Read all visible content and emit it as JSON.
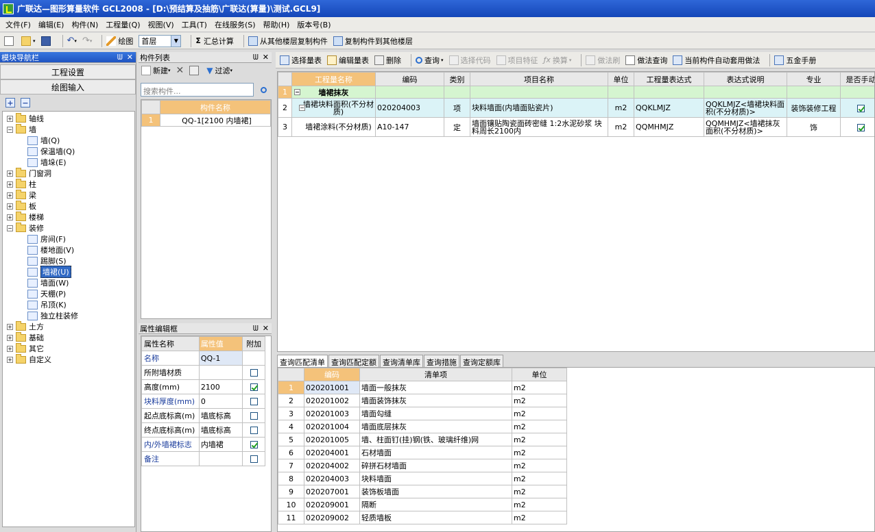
{
  "window": {
    "title": "广联达—图形算量软件 GCL2008 - [D:\\预结算及抽筋\\广联达(算量)\\测试.GCL9]"
  },
  "menu": [
    "文件(F)",
    "编辑(E)",
    "构件(N)",
    "工程量(Q)",
    "视图(V)",
    "工具(T)",
    "在线服务(S)",
    "帮助(H)",
    "版本号(B)"
  ],
  "toolbar": {
    "draw_label": "绘图",
    "floor_value": "首层",
    "summary_label": "汇总计算",
    "copy_from_label": "从其他楼层复制构件",
    "copy_to_label": "复制构件到其他楼层"
  },
  "nav": {
    "title": "模块导航栏",
    "project_settings": "工程设置",
    "drawing_input": "绘图输入"
  },
  "tree": [
    {
      "label": "轴线",
      "level": 0,
      "type": "folder",
      "exp": "+"
    },
    {
      "label": "墙",
      "level": 0,
      "type": "folder",
      "exp": "-"
    },
    {
      "label": "墙(Q)",
      "level": 1,
      "type": "leaf"
    },
    {
      "label": "保温墙(Q)",
      "level": 1,
      "type": "leaf"
    },
    {
      "label": "墙垛(E)",
      "level": 1,
      "type": "leaf"
    },
    {
      "label": "门窗洞",
      "level": 0,
      "type": "folder",
      "exp": "+"
    },
    {
      "label": "柱",
      "level": 0,
      "type": "folder",
      "exp": "+"
    },
    {
      "label": "梁",
      "level": 0,
      "type": "folder",
      "exp": "+"
    },
    {
      "label": "板",
      "level": 0,
      "type": "folder",
      "exp": "+"
    },
    {
      "label": "楼梯",
      "level": 0,
      "type": "folder",
      "exp": "+"
    },
    {
      "label": "装修",
      "level": 0,
      "type": "folder",
      "exp": "-"
    },
    {
      "label": "房间(F)",
      "level": 1,
      "type": "leaf"
    },
    {
      "label": "楼地面(V)",
      "level": 1,
      "type": "leaf"
    },
    {
      "label": "踢脚(S)",
      "level": 1,
      "type": "leaf"
    },
    {
      "label": "墙裙(U)",
      "level": 1,
      "type": "leaf",
      "selected": true
    },
    {
      "label": "墙面(W)",
      "level": 1,
      "type": "leaf"
    },
    {
      "label": "天棚(P)",
      "level": 1,
      "type": "leaf"
    },
    {
      "label": "吊顶(K)",
      "level": 1,
      "type": "leaf"
    },
    {
      "label": "独立柱装修",
      "level": 1,
      "type": "leaf"
    },
    {
      "label": "土方",
      "level": 0,
      "type": "folder",
      "exp": "+"
    },
    {
      "label": "基础",
      "level": 0,
      "type": "folder",
      "exp": "+"
    },
    {
      "label": "其它",
      "level": 0,
      "type": "folder",
      "exp": "+"
    },
    {
      "label": "自定义",
      "level": 0,
      "type": "folder",
      "exp": "+"
    }
  ],
  "components": {
    "title": "构件列表",
    "new_label": "新建",
    "filter_label": "过滤",
    "search_placeholder": "搜索构件...",
    "col_name": "构件名称",
    "rows": [
      {
        "idx": "1",
        "name": "QQ-1[2100 内墙裙]"
      }
    ]
  },
  "props": {
    "title": "属性编辑框",
    "col_name": "属性名称",
    "col_value": "属性值",
    "col_extra": "附加",
    "rows": [
      {
        "name": "名称",
        "value": "QQ-1",
        "checkbox": "none",
        "blue": true
      },
      {
        "name": "所附墙材质",
        "value": "",
        "checkbox": "off",
        "blue": false
      },
      {
        "name": "高度(mm)",
        "value": "2100",
        "checkbox": "on",
        "blue": false
      },
      {
        "name": "块料厚度(mm)",
        "value": "0",
        "checkbox": "off",
        "blue": true
      },
      {
        "name": "起点底标高(m)",
        "value": "墙底标高",
        "checkbox": "off",
        "blue": false
      },
      {
        "name": "终点底标高(m)",
        "value": "墙底标高",
        "checkbox": "off",
        "blue": false
      },
      {
        "name": "内/外墙裙标志",
        "value": "内墙裙",
        "checkbox": "on",
        "blue": true
      },
      {
        "name": "备注",
        "value": "",
        "checkbox": "off",
        "blue": true
      }
    ]
  },
  "qtoolbar": {
    "select_list": "选择量表",
    "edit_list": "编辑量表",
    "delete": "删除",
    "query": "查询",
    "select_code": "选择代码",
    "item_feature": "项目特征",
    "convert": "换算",
    "brush": "做法刷",
    "method_query": "做法查询",
    "auto_apply": "当前构件自动套用做法",
    "hardware": "五金手册"
  },
  "qtable": {
    "headers": [
      "工程量名称",
      "编码",
      "类别",
      "项目名称",
      "单位",
      "工程量表达式",
      "表达式说明",
      "专业",
      "是否手动"
    ],
    "group": {
      "idx": "1",
      "label": "墙裙抹灰"
    },
    "rows": [
      {
        "idx": "2",
        "name": "墙裙块料面积(不分材质)",
        "code": "020204003",
        "type": "项",
        "item": "块料墙面(内墙面贴瓷片)",
        "unit": "m2",
        "expr": "QQKLMJZ",
        "desc": "QQKLMJZ<墙裙块料面积(不分材质)>",
        "major": "装饰装修工程",
        "manual": true
      },
      {
        "idx": "3",
        "name": "墙裙涂料(不分材质)",
        "code": "A10-147",
        "type": "定",
        "item": "墙面镶贴陶瓷面砖密缝 1:2水泥砂浆 块料周长2100内",
        "unit": "m2",
        "expr": "QQMHMJZ",
        "desc": "QQMHMJZ<墙裙抹灰面积(不分材质)>",
        "major": "饰",
        "manual": true
      }
    ]
  },
  "tabs": [
    "查询匹配清单",
    "查询匹配定额",
    "查询清单库",
    "查询措施",
    "查询定额库"
  ],
  "listtable": {
    "headers": [
      "编码",
      "清单项",
      "单位"
    ],
    "rows": [
      {
        "idx": "1",
        "code": "020201001",
        "item": "墙面一般抹灰",
        "unit": "m2"
      },
      {
        "idx": "2",
        "code": "020201002",
        "item": "墙面装饰抹灰",
        "unit": "m2"
      },
      {
        "idx": "3",
        "code": "020201003",
        "item": "墙面勾缝",
        "unit": "m2"
      },
      {
        "idx": "4",
        "code": "020201004",
        "item": "墙面底层抹灰",
        "unit": "m2"
      },
      {
        "idx": "5",
        "code": "020201005",
        "item": "墙、柱面钉(挂)钢(铁、玻璃纤维)网",
        "unit": "m2"
      },
      {
        "idx": "6",
        "code": "020204001",
        "item": "石材墙面",
        "unit": "m2"
      },
      {
        "idx": "7",
        "code": "020204002",
        "item": "碎拼石材墙面",
        "unit": "m2"
      },
      {
        "idx": "8",
        "code": "020204003",
        "item": "块料墙面",
        "unit": "m2"
      },
      {
        "idx": "9",
        "code": "020207001",
        "item": "装饰板墙面",
        "unit": "m2"
      },
      {
        "idx": "10",
        "code": "020209001",
        "item": "隔断",
        "unit": "m2"
      },
      {
        "idx": "11",
        "code": "020209002",
        "item": "轻质墙板",
        "unit": "m2"
      }
    ]
  }
}
